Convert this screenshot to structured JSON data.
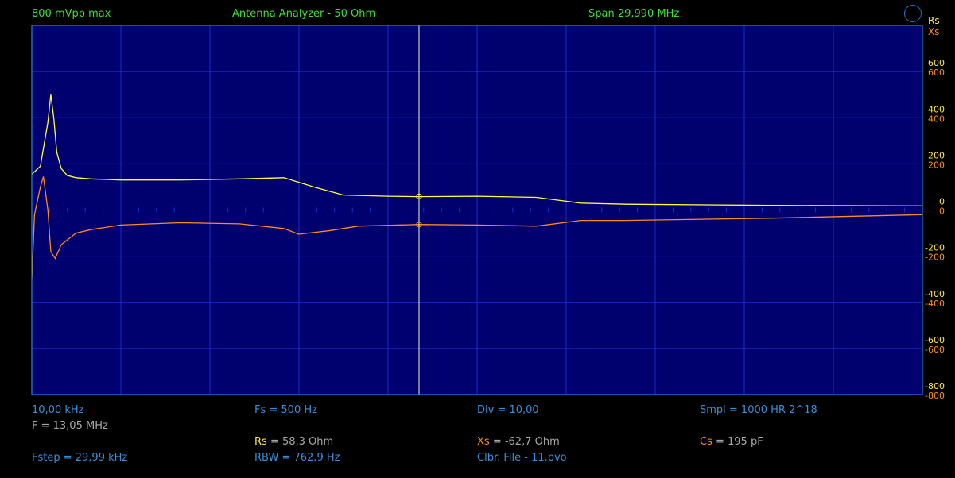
{
  "header": {
    "amplitude": "800 mVpp max",
    "mode_title": "Antenna Analyzer - 50 Ohm",
    "span": "Span 29,990 MHz",
    "status_icon": "circle-status-icon"
  },
  "legend": {
    "rs_label": "Rs",
    "xs_label": "Xs"
  },
  "footer": {
    "start_freq": "10,00 kHz",
    "fs": "Fs = 500 Hz",
    "div": "Div = 10,00",
    "smpl": "Smpl = 1000 HR  2^18",
    "cursor_freq": "F = 13,05 MHz",
    "rs_name": "Rs",
    "rs_value": " = 58,3 Ohm",
    "xs_name": "Xs",
    "xs_value": " = -62,7 Ohm",
    "cs_name": "Cs",
    "cs_value": " = 195 pF",
    "fstep": "Fstep = 29,99 kHz",
    "rbw": "RBW = 762,9 Hz",
    "clbr": "Clbr. File - 11.pvo"
  },
  "colors": {
    "rs": "#ffff40",
    "xs": "#ff8a1e",
    "plot_bg": "#00006e",
    "grid": "#1a2dcc",
    "border": "#2d7fd6",
    "cursor": "#f5f5c8"
  },
  "chart_data": {
    "type": "line",
    "xlim": [
      0.01,
      30.0
    ],
    "ylim": [
      -800,
      800
    ],
    "grid": true,
    "x_divisions": 10,
    "y_divisions": 8,
    "y_ticks_rs": [
      "600",
      "400",
      "200",
      "0",
      "-200",
      "-400",
      "-600",
      "-800"
    ],
    "y_ticks_xs": [
      "600",
      "400",
      "200",
      "0",
      "-200",
      "-400",
      "-600",
      "-800"
    ],
    "y_tick_values": [
      600,
      400,
      200,
      0,
      -200,
      -400,
      -600,
      -800
    ],
    "cursor_x": 13.05,
    "series": [
      {
        "name": "Rs",
        "x": [
          0.01,
          0.3,
          0.55,
          0.65,
          0.75,
          0.85,
          1.0,
          1.2,
          1.5,
          2.0,
          3.0,
          5.0,
          7.0,
          8.5,
          9.5,
          10.5,
          12.0,
          13.05,
          15.0,
          17.0,
          18.5,
          20.0,
          25.0,
          30.0
        ],
        "values": [
          155,
          190,
          380,
          500,
          400,
          250,
          180,
          150,
          140,
          135,
          130,
          130,
          135,
          140,
          100,
          65,
          60,
          58.3,
          60,
          55,
          30,
          25,
          20,
          18
        ]
      },
      {
        "name": "Xs",
        "x": [
          0.01,
          0.1,
          0.3,
          0.4,
          0.55,
          0.65,
          0.8,
          1.0,
          1.5,
          2.0,
          3.0,
          5.0,
          7.0,
          8.5,
          9.0,
          10.0,
          11.0,
          13.05,
          15.0,
          17.0,
          18.5,
          20.0,
          25.0,
          30.0
        ],
        "values": [
          -300,
          -20,
          100,
          145,
          0,
          -180,
          -210,
          -150,
          -100,
          -85,
          -65,
          -55,
          -60,
          -80,
          -105,
          -90,
          -70,
          -62.7,
          -65,
          -70,
          -45,
          -45,
          -35,
          -20
        ]
      }
    ]
  }
}
